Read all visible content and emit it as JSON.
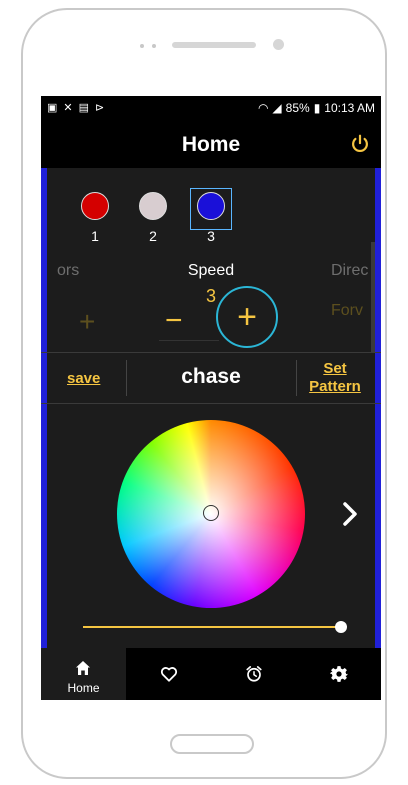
{
  "status_bar": {
    "battery": "85%",
    "time": "10:13 AM"
  },
  "header": {
    "title": "Home"
  },
  "colors": {
    "items": [
      {
        "num": "1",
        "color": "#d40000"
      },
      {
        "num": "2",
        "color": "#d8cdd0"
      },
      {
        "num": "3",
        "color": "#1a10d8"
      }
    ],
    "selected": "3"
  },
  "controls": {
    "colors_label_partial": "ors",
    "speed_label": "Speed",
    "speed_value": "3",
    "direction_label_partial": "Direc",
    "direction_value_partial": "Forv",
    "minus": "−",
    "plus": "+"
  },
  "actions": {
    "save": "save",
    "pattern_name": "chase",
    "set_pattern": "Set Pattern"
  },
  "brightness": 1.0,
  "tabs": [
    {
      "label": "Home",
      "icon": "home-icon",
      "active": true
    },
    {
      "label": "",
      "icon": "heart-icon",
      "active": false
    },
    {
      "label": "",
      "icon": "alarm-icon",
      "active": false
    },
    {
      "label": "",
      "icon": "gear-icon",
      "active": false
    }
  ],
  "theme": {
    "accent": "#f5c542",
    "side_bar": "#2020d8",
    "focus_ring": "#2bb6d6"
  }
}
